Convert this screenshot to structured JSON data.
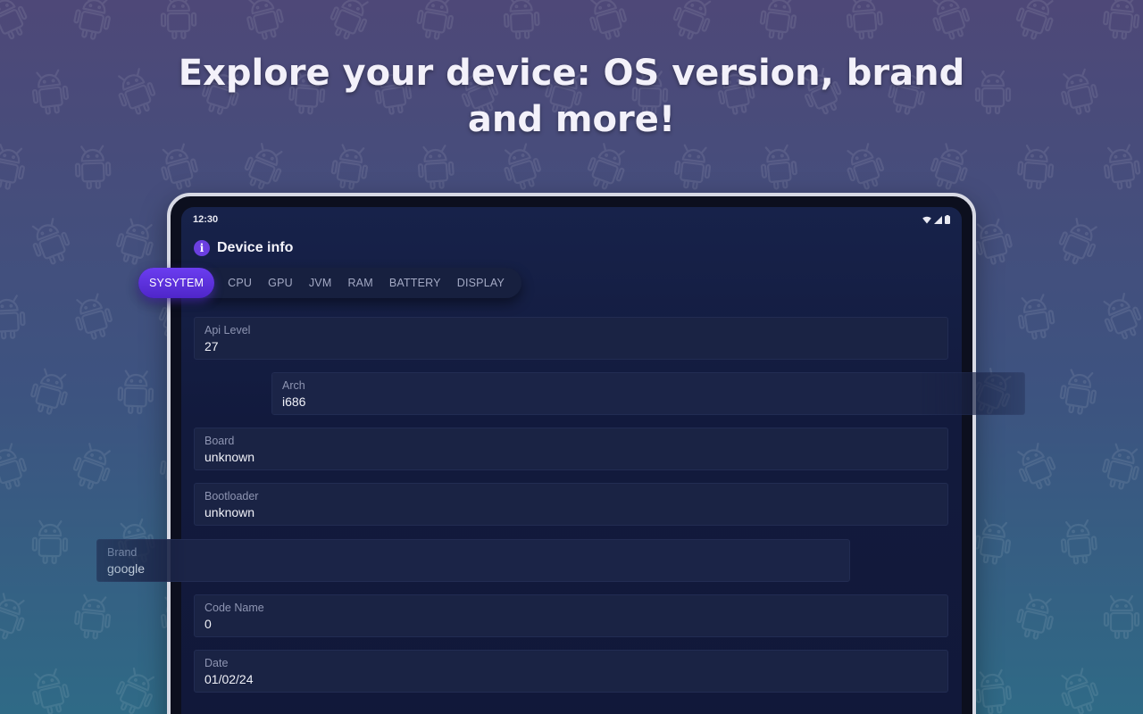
{
  "headline": {
    "line1": "Explore your device: OS version, brand",
    "line2": "and more!"
  },
  "background": {
    "gradient_top": "#4e4878",
    "gradient_bottom": "#2f6a86",
    "pattern_icon": "android-robot-icon"
  },
  "device": {
    "status_bar": {
      "time": "12:30",
      "icons": [
        "wifi-icon",
        "signal-icon",
        "battery-icon"
      ]
    },
    "app": {
      "title": "Device info",
      "title_icon": "info-icon",
      "accent_color": "#5b30d8"
    },
    "tabs": [
      {
        "label": "SYSYTEM",
        "active": true
      },
      {
        "label": "CPU",
        "active": false
      },
      {
        "label": "GPU",
        "active": false
      },
      {
        "label": "JVM",
        "active": false
      },
      {
        "label": "RAM",
        "active": false
      },
      {
        "label": "BATTERY",
        "active": false
      },
      {
        "label": "DISPLAY",
        "active": false
      }
    ],
    "info_items": [
      {
        "label": "Api Level",
        "value": "27"
      },
      {
        "label": "Arch",
        "value": "i686"
      },
      {
        "label": "Board",
        "value": "unknown"
      },
      {
        "label": "Bootloader",
        "value": "unknown"
      },
      {
        "label": "Brand",
        "value": "google"
      },
      {
        "label": "Code Name",
        "value": "0"
      },
      {
        "label": "Date",
        "value": "01/02/24"
      }
    ]
  }
}
